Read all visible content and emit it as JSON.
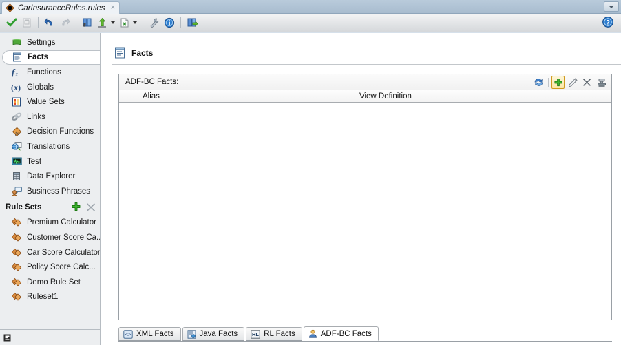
{
  "window": {
    "document_tab": {
      "label": "CarInsuranceRules.rules",
      "icon": "rules-diamond-icon",
      "close_label": "×"
    },
    "tab_dropdown_name": "tab-list-dropdown"
  },
  "toolbar": {
    "buttons": [
      {
        "name": "validate-button",
        "icon": "green-check-icon",
        "enabled": true
      },
      {
        "name": "snapshot-button",
        "icon": "document-snapshot-icon",
        "enabled": false
      },
      {
        "name": "undo-button",
        "icon": "undo-arrow-icon",
        "enabled": true
      },
      {
        "name": "redo-button",
        "icon": "redo-arrow-icon",
        "enabled": false
      },
      {
        "name": "import-dictionary-button",
        "icon": "dictionary-blue-icon",
        "enabled": true
      },
      {
        "name": "update-dictionary-button",
        "icon": "green-up-arrow-icon",
        "enabled": true,
        "has_dropdown": true
      },
      {
        "name": "export-button",
        "icon": "document-export-icon",
        "enabled": true,
        "has_dropdown": true
      },
      {
        "name": "properties-button",
        "icon": "wrench-icon",
        "enabled": true
      },
      {
        "name": "info-button",
        "icon": "info-circle-icon",
        "enabled": true
      },
      {
        "name": "link-dictionary-button",
        "icon": "dictionary-green-icon",
        "enabled": true
      }
    ],
    "help": {
      "name": "help-button",
      "icon": "help-question-icon"
    }
  },
  "sidebar": {
    "items": [
      {
        "label": "Settings",
        "icon": "settings-book-icon",
        "selected": false
      },
      {
        "label": "Facts",
        "icon": "facts-list-icon",
        "selected": true
      },
      {
        "label": "Functions",
        "icon": "function-fx-icon",
        "selected": false
      },
      {
        "label": "Globals",
        "icon": "globals-variable-icon",
        "selected": false
      },
      {
        "label": "Value Sets",
        "icon": "value-sets-table-icon",
        "selected": false
      },
      {
        "label": "Links",
        "icon": "links-chain-icon",
        "selected": false
      },
      {
        "label": "Decision Functions",
        "icon": "decision-functions-icon",
        "selected": false
      },
      {
        "label": "Translations",
        "icon": "translations-icon",
        "selected": false
      },
      {
        "label": "Test",
        "icon": "test-monitor-icon",
        "selected": false
      },
      {
        "label": "Data Explorer",
        "icon": "data-explorer-db-icon",
        "selected": false
      },
      {
        "label": "Business Phrases",
        "icon": "business-phrases-icon",
        "selected": false
      }
    ],
    "rule_sets": {
      "header": "Rule Sets",
      "add_button": {
        "name": "add-ruleset-button",
        "icon": "green-plus-icon"
      },
      "delete_button": {
        "name": "delete-ruleset-button",
        "icon": "grey-x-icon"
      },
      "items": [
        {
          "label": "Premium Calculator",
          "icon": "ruleset-diamond-icon"
        },
        {
          "label": "Customer Score Ca...",
          "icon": "ruleset-diamond-icon"
        },
        {
          "label": "Car Score Calculator",
          "icon": "ruleset-diamond-icon"
        },
        {
          "label": "Policy Score Calc...",
          "icon": "ruleset-diamond-icon"
        },
        {
          "label": "Demo Rule Set",
          "icon": "ruleset-diamond-icon"
        },
        {
          "label": "Ruleset1",
          "icon": "ruleset-diamond-icon"
        }
      ]
    },
    "status_icon": "editor-mode-icon"
  },
  "main": {
    "page_title": "Facts",
    "page_title_icon": "facts-list-icon",
    "panel": {
      "title_prefix": "A",
      "title_mnemonic": "D",
      "title_suffix": "F-BC Facts:",
      "title_full": "ADF-BC Facts:",
      "tools": [
        {
          "name": "refresh-facts-button",
          "icon": "refresh-blue-icon",
          "highlighted": false
        },
        {
          "name": "add-fact-button",
          "icon": "green-plus-icon",
          "highlighted": true
        },
        {
          "name": "edit-fact-button",
          "icon": "pencil-edit-icon",
          "highlighted": false
        },
        {
          "name": "delete-fact-button",
          "icon": "grey-x-icon",
          "highlighted": false
        },
        {
          "name": "import-fact-button",
          "icon": "stamp-import-icon",
          "highlighted": false
        }
      ],
      "grid": {
        "columns": [
          "",
          "Alias",
          "View Definition"
        ],
        "rows": []
      }
    },
    "bottom_tabs": [
      {
        "label": "XML Facts",
        "icon": "xml-brackets-icon",
        "active": false
      },
      {
        "label": "Java Facts",
        "icon": "java-page-icon",
        "active": false
      },
      {
        "label": "RL Facts",
        "icon": "rl-badge-icon",
        "active": false
      },
      {
        "label": "ADF-BC Facts",
        "icon": "adfbc-person-icon",
        "active": true
      }
    ]
  },
  "colors": {
    "accent_blue": "#3d6fa5",
    "titlebar": "#b9cbdb",
    "sidebar_bg": "#eceef0",
    "highlight_border": "#d09a1e",
    "green": "#3ba336",
    "panel_border": "#9aa0a6"
  }
}
